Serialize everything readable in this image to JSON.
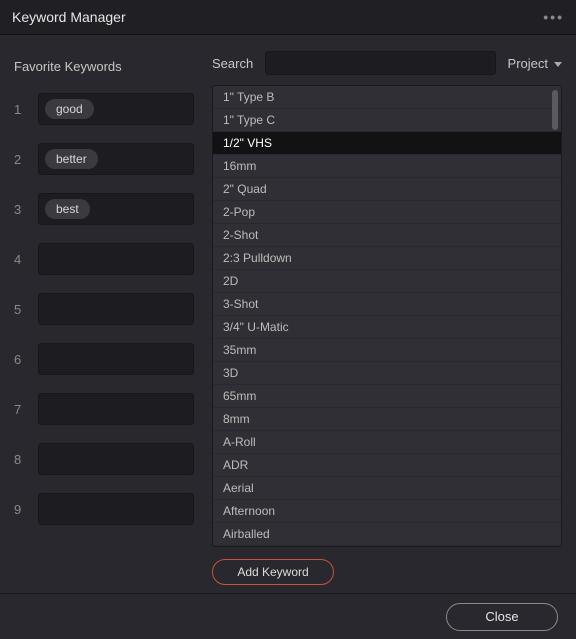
{
  "window": {
    "title": "Keyword Manager"
  },
  "favorites": {
    "header": "Favorite Keywords",
    "slots": [
      {
        "num": "1",
        "tag": "good"
      },
      {
        "num": "2",
        "tag": "better"
      },
      {
        "num": "3",
        "tag": "best"
      },
      {
        "num": "4",
        "tag": ""
      },
      {
        "num": "5",
        "tag": ""
      },
      {
        "num": "6",
        "tag": ""
      },
      {
        "num": "7",
        "tag": ""
      },
      {
        "num": "8",
        "tag": ""
      },
      {
        "num": "9",
        "tag": ""
      }
    ]
  },
  "search": {
    "label": "Search",
    "value": "",
    "scope": "Project"
  },
  "keywords": {
    "selected_index": 2,
    "items": [
      "1\" Type B",
      "1\" Type C",
      "1/2\" VHS",
      "16mm",
      "2\" Quad",
      "2-Pop",
      "2-Shot",
      "2:3 Pulldown",
      "2D",
      "3-Shot",
      "3/4\" U-Matic",
      "35mm",
      "3D",
      "65mm",
      "8mm",
      "A-Roll",
      "ADR",
      "Aerial",
      "Afternoon",
      "Airballed"
    ]
  },
  "buttons": {
    "add": "Add Keyword",
    "close": "Close"
  }
}
